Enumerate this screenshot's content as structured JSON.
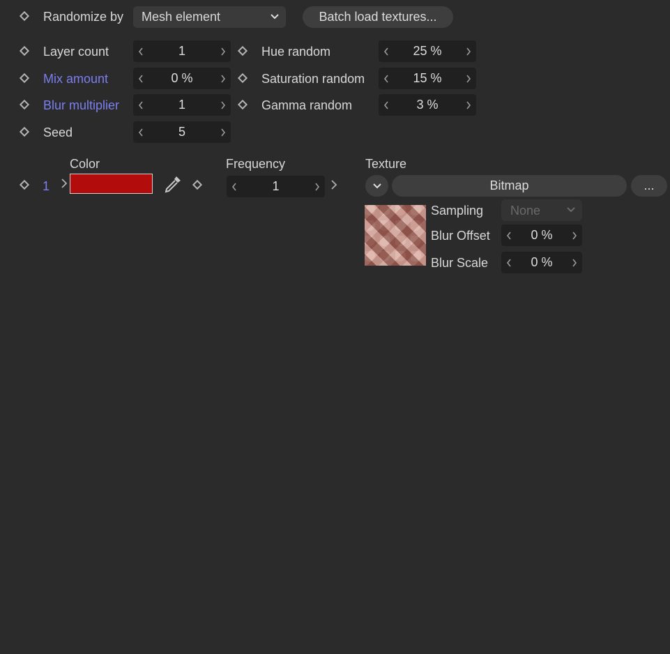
{
  "header": {
    "randomize_label": "Randomize by",
    "randomize_value": "Mesh element",
    "batch_button": "Batch load textures..."
  },
  "params_left": [
    {
      "label": "Layer count",
      "value": "1"
    },
    {
      "label": "Mix amount",
      "value": "0 %"
    },
    {
      "label": "Blur multiplier",
      "value": "1"
    },
    {
      "label": "Seed",
      "value": "5"
    }
  ],
  "params_right": [
    {
      "label": "Hue random",
      "value": "25 %"
    },
    {
      "label": "Saturation random",
      "value": "15 %"
    },
    {
      "label": "Gamma random",
      "value": "3 %"
    }
  ],
  "layer": {
    "index": "1",
    "color_header": "Color",
    "color_value": "#b30c0c",
    "frequency_header": "Frequency",
    "frequency_value": "1",
    "texture_header": "Texture",
    "texture_button": "Bitmap",
    "more_button": "...",
    "sampling_label": "Sampling",
    "sampling_value": "None",
    "blur_offset_label": "Blur Offset",
    "blur_offset_value": "0 %",
    "blur_scale_label": "Blur Scale",
    "blur_scale_value": "0 %"
  },
  "colors": {
    "background": "#2b2b2b",
    "accent_label": "#7b7ff0",
    "field_bg": "#202020"
  }
}
